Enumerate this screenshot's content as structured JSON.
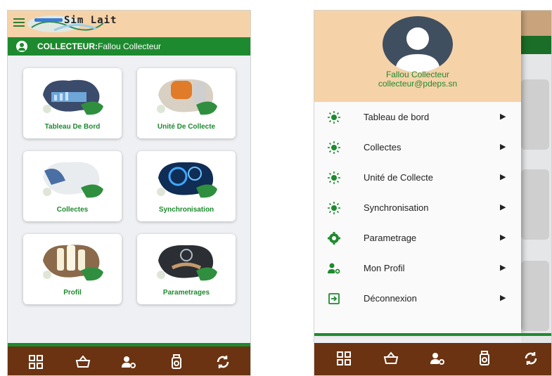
{
  "left_screen": {
    "app_title": "Sim Lait",
    "collector_label": "COLLECTEUR:",
    "collector_name": "Fallou Collecteur",
    "tiles": [
      {
        "label": "Tableau De Bord",
        "icon": "dashboard-illustration"
      },
      {
        "label": "Unité De Collecte",
        "icon": "collection-unit-illustration"
      },
      {
        "label": "Collectes",
        "icon": "milk-collection-illustration"
      },
      {
        "label": "Synchronisation",
        "icon": "sync-gears-illustration"
      },
      {
        "label": "Profil",
        "icon": "milk-bottles-illustration"
      },
      {
        "label": "Parametrages",
        "icon": "settings-illustration"
      }
    ]
  },
  "drawer": {
    "user_name": "Fallou Collecteur",
    "user_email": "collecteur@pdeps.sn",
    "items": [
      {
        "label": "Tableau de bord",
        "icon": "sun-icon"
      },
      {
        "label": "Collectes",
        "icon": "sun-icon"
      },
      {
        "label": "Unité de Collecte",
        "icon": "sun-icon"
      },
      {
        "label": "Synchronisation",
        "icon": "sun-icon"
      },
      {
        "label": "Parametrage",
        "icon": "gear-icon"
      },
      {
        "label": "Mon Profil",
        "icon": "user-settings-icon"
      },
      {
        "label": "Déconnexion",
        "icon": "logout-icon"
      }
    ],
    "arrow": "▶"
  },
  "bottom_nav": [
    {
      "icon": "grid-icon"
    },
    {
      "icon": "basket-icon"
    },
    {
      "icon": "user-settings-icon"
    },
    {
      "icon": "milk-can-icon"
    },
    {
      "icon": "sync-icon"
    }
  ],
  "colors": {
    "header": "#f6d2a8",
    "primary_green": "#1e8a2f",
    "bottom_bar": "#6b3311",
    "background": "#eef0f3"
  }
}
